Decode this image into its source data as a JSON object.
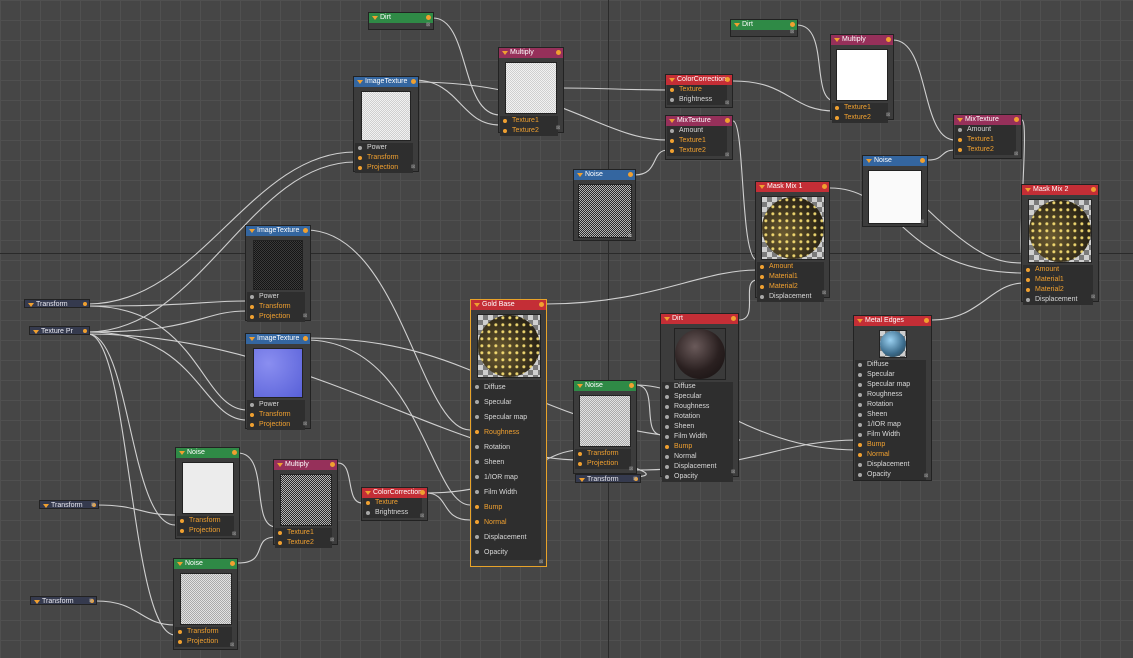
{
  "nodes": {
    "dirt1": {
      "title": "Dirt"
    },
    "dirt2": {
      "title": "Dirt"
    },
    "multiply1": {
      "title": "Multiply",
      "ports": [
        "Texture1",
        "Texture2"
      ]
    },
    "multiply2": {
      "title": "Multiply",
      "ports": [
        "Texture1",
        "Texture2"
      ]
    },
    "multiply3": {
      "title": "Multiply",
      "ports": [
        "Texture1",
        "Texture2"
      ]
    },
    "image1": {
      "title": "ImageTexture",
      "ports": [
        "Power",
        "Transform",
        "Projection"
      ]
    },
    "image2": {
      "title": "ImageTexture",
      "ports": [
        "Power",
        "Transform",
        "Projection"
      ]
    },
    "image3": {
      "title": "ImageTexture",
      "ports": [
        "Power",
        "Transform",
        "Projection"
      ]
    },
    "cc1": {
      "title": "ColorCorrection",
      "ports": [
        "Texture",
        "Brightness"
      ]
    },
    "cc2": {
      "title": "ColorCorrection",
      "ports": [
        "Texture",
        "Brightness"
      ]
    },
    "mix1": {
      "title": "MixTexture",
      "ports": [
        "Amount",
        "Texture1",
        "Texture2"
      ]
    },
    "mix2": {
      "title": "MixTexture",
      "ports": [
        "Amount",
        "Texture1",
        "Texture2"
      ]
    },
    "noise1": {
      "title": "Noise"
    },
    "noise2": {
      "title": "Noise"
    },
    "noise3": {
      "title": "Noise",
      "ports": [
        "Transform",
        "Projection"
      ]
    },
    "noise4": {
      "title": "Noise",
      "ports": [
        "Transform",
        "Projection"
      ]
    },
    "noise5": {
      "title": "Noise",
      "ports": [
        "Transform",
        "Projection"
      ]
    },
    "maskmix1": {
      "title": "Mask Mix 1",
      "ports": [
        "Amount",
        "Material1",
        "Material2",
        "Displacement"
      ]
    },
    "maskmix2": {
      "title": "Mask Mix 2",
      "ports": [
        "Amount",
        "Material1",
        "Material2",
        "Displacement"
      ]
    },
    "goldbase": {
      "title": "Gold Base",
      "ports": [
        "Diffuse",
        "Specular",
        "Specular map",
        "Roughness",
        "Rotation",
        "Sheen",
        "1/IOR map",
        "Film Width",
        "Bump",
        "Normal",
        "Displacement",
        "Opacity"
      ]
    },
    "dirtmat": {
      "title": "Dirt",
      "ports": [
        "Diffuse",
        "Specular",
        "Roughness",
        "Rotation",
        "Sheen",
        "Film Width",
        "Bump",
        "Normal",
        "Displacement",
        "Opacity"
      ]
    },
    "metaledges": {
      "title": "Metal Edges",
      "ports": [
        "Diffuse",
        "Specular",
        "Specular map",
        "Roughness",
        "Rotation",
        "Sheen",
        "1/IOR map",
        "Film Width",
        "Bump",
        "Normal",
        "Displacement",
        "Opacity"
      ]
    }
  },
  "pointers": {
    "transform1": "Transform",
    "texturepr": "Texture Pr",
    "transform2": "Transform",
    "transform3": "Transform",
    "transform4": "Transform"
  },
  "resize_glyph": "⊠",
  "colors": {
    "background": "#464646",
    "selection": "#e8a32a",
    "active_port": "#f0a030"
  }
}
